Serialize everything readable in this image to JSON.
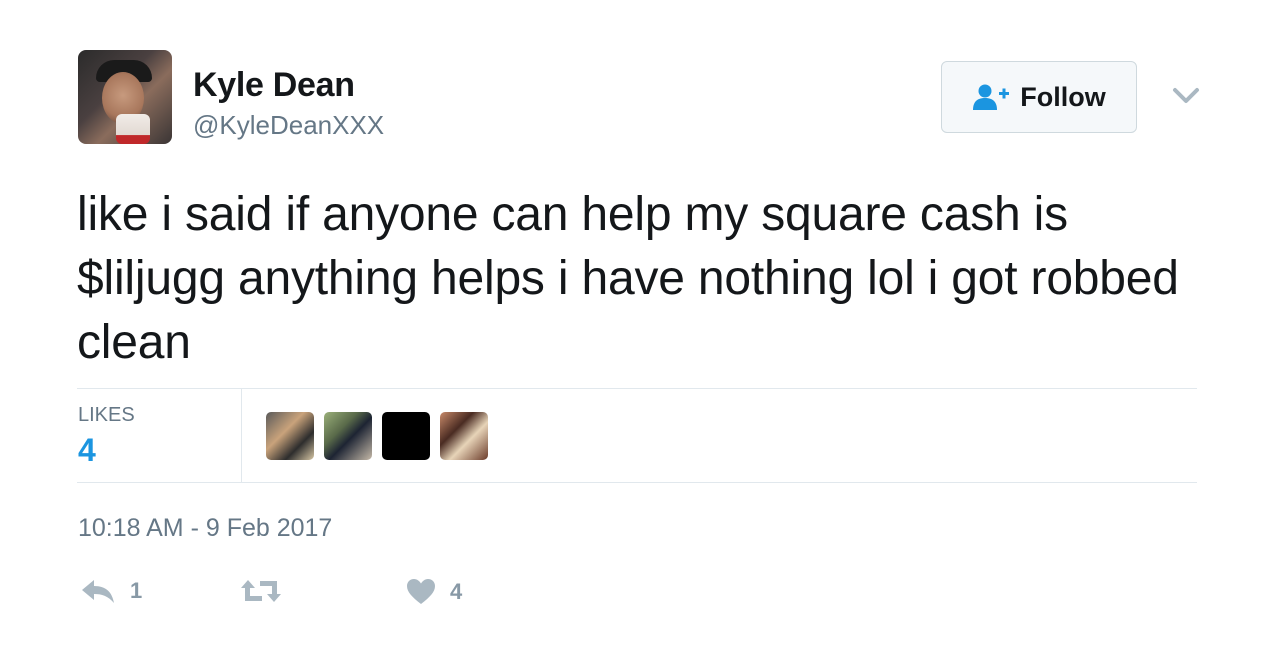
{
  "user": {
    "name": "Kyle Dean",
    "handle": "@KyleDeanXXX"
  },
  "follow_button": {
    "label": "Follow",
    "icon": "add-user-icon"
  },
  "menu": {
    "icon": "chevron-down-icon"
  },
  "tweet": {
    "text": "like i said if anyone can help my square cash is $liljugg anything helps i have nothing lol i got robbed clean",
    "timestamp": "10:18 AM - 9 Feb 2017"
  },
  "stats": {
    "likes_label": "LIKES",
    "likes_count": "4",
    "likers_shown": 4
  },
  "actions": {
    "reply": {
      "icon": "reply-icon",
      "count": "1"
    },
    "retweet": {
      "icon": "retweet-icon",
      "count": ""
    },
    "like": {
      "icon": "heart-icon",
      "count": "4"
    }
  },
  "colors": {
    "text_primary": "#14171a",
    "text_secondary": "#657786",
    "accent": "#1b95e0",
    "divider": "#e1e8ed",
    "action_gray": "#8899a6"
  }
}
